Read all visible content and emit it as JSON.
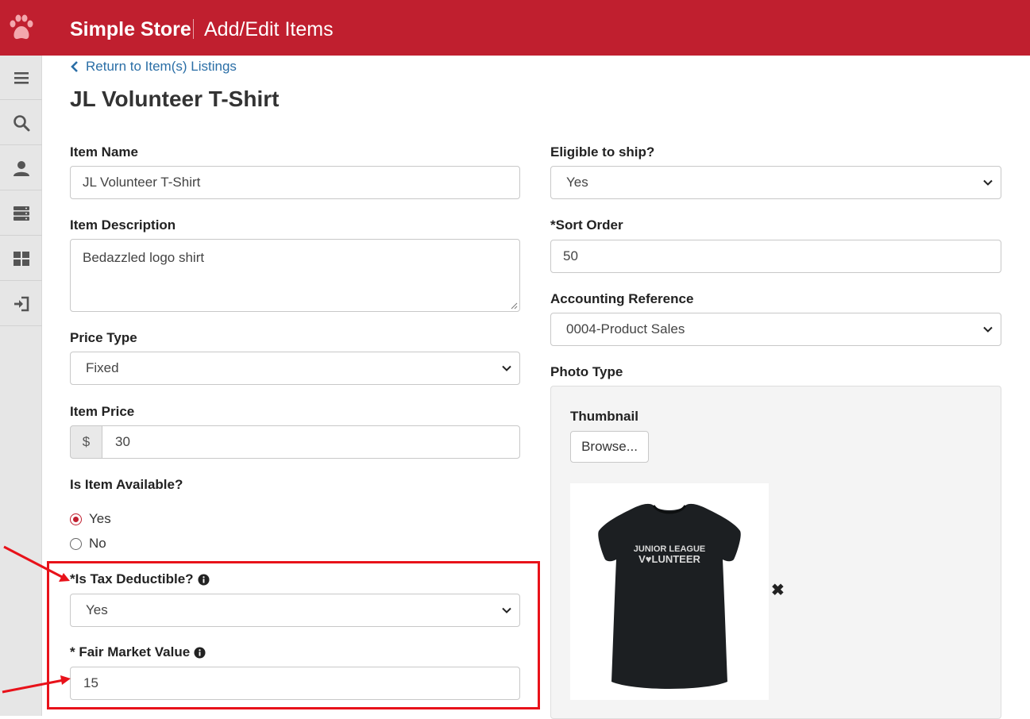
{
  "header": {
    "app_title": "Simple Store",
    "section_title": "Add/Edit Items",
    "brand_color": "#c01f2f"
  },
  "sidebar": {
    "items": [
      {
        "icon": "menu-icon"
      },
      {
        "icon": "search-icon"
      },
      {
        "icon": "user-icon"
      },
      {
        "icon": "server-icon"
      },
      {
        "icon": "dashboard-icon"
      },
      {
        "icon": "sign-in-icon"
      }
    ]
  },
  "page": {
    "back_link": "Return to Item(s) Listings",
    "heading": "JL Volunteer T-Shirt"
  },
  "form": {
    "item_name": {
      "label": "Item Name",
      "value": "JL Volunteer T-Shirt"
    },
    "item_description": {
      "label": "Item Description",
      "value": "Bedazzled logo shirt"
    },
    "price_type": {
      "label": "Price Type",
      "value": "Fixed"
    },
    "item_price": {
      "label": "Item Price",
      "currency": "$",
      "value": "30"
    },
    "is_available": {
      "label": "Is Item Available?",
      "options": [
        "Yes",
        "No"
      ],
      "selected": "Yes"
    },
    "tax_deductible": {
      "label": "*Is Tax Deductible?",
      "value": "Yes"
    },
    "fair_market_value": {
      "label": "* Fair Market Value",
      "value": "15"
    },
    "eligible_to_ship": {
      "label": "Eligible to ship?",
      "value": "Yes"
    },
    "sort_order": {
      "label": "*Sort Order",
      "value": "50"
    },
    "accounting_reference": {
      "label": "Accounting Reference",
      "value": "0004-Product Sales"
    },
    "photo_type": {
      "label": "Photo Type",
      "thumbnail_label": "Thumbnail",
      "browse_label": "Browse...",
      "remove_label": "✖"
    }
  },
  "thumbnail_image": {
    "text_line1": "JUNIOR LEAGUE",
    "text_line2": "V♥LUNTEER"
  },
  "annotation": {
    "color": "#e8121a"
  }
}
